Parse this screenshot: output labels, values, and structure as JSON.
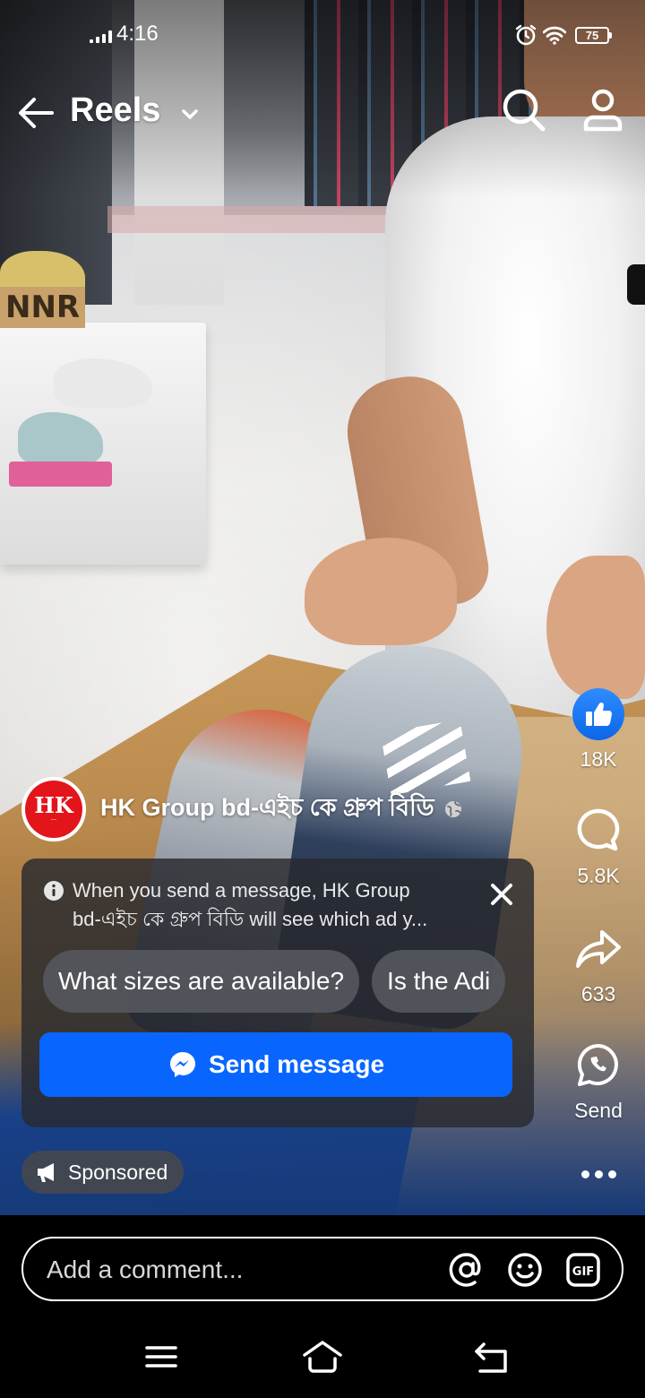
{
  "status_bar": {
    "time": "4:16",
    "battery": "75"
  },
  "header": {
    "back_icon": "arrow-left-icon",
    "title": "Reels",
    "dropdown_icon": "chevron-down-icon",
    "search_icon": "search-icon",
    "profile_icon": "profile-icon"
  },
  "actions": {
    "like_count": "18K",
    "comment_count": "5.8K",
    "share_count": "633",
    "whatsapp_label": "Send",
    "accent": "#0866ff"
  },
  "ad": {
    "page_name": "HK Group bd-এইচ কে গ্রুপ বিডি",
    "avatar_text": "HK",
    "message_notice_line1": "When you send a message, HK Group",
    "message_notice_line2": "bd-এইচ কে গ্রুপ বিডি will see which ad y...",
    "quick_replies": [
      "What sizes are available?",
      "Is the Adi"
    ],
    "send_button_label": "Send message",
    "sponsored_label": "Sponsored"
  },
  "comment_bar": {
    "placeholder": "Add a comment..."
  }
}
